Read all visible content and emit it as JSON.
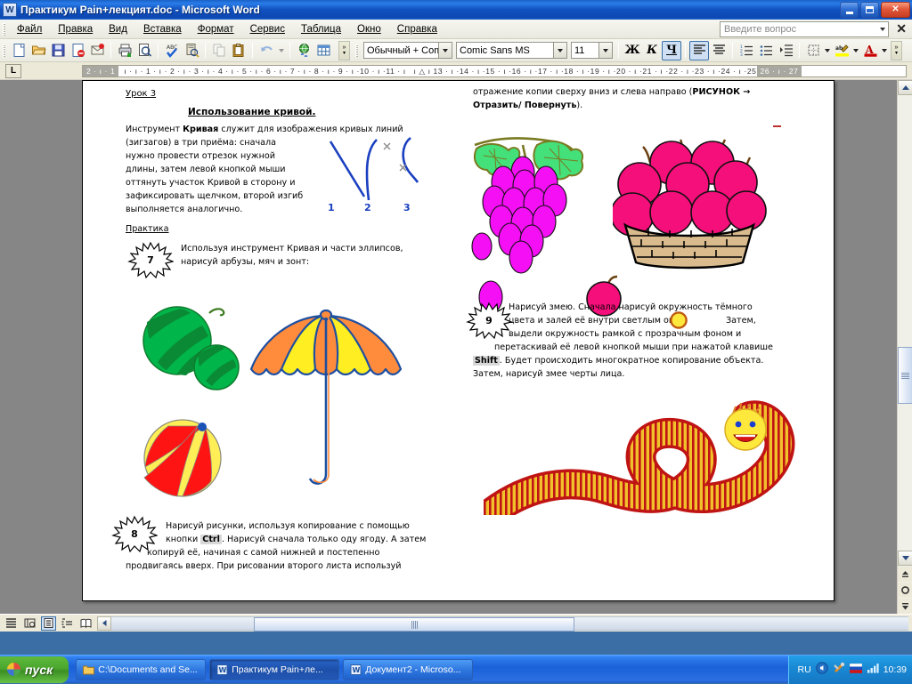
{
  "window": {
    "title": "Практикум  Pain+лекцият.doc - Microsoft Word",
    "icon": "word-document-icon",
    "minimize_label": "minimize",
    "maximize_label": "restore",
    "close_label": "close"
  },
  "menu": {
    "items": [
      "Файл",
      "Правка",
      "Вид",
      "Вставка",
      "Формат",
      "Сервис",
      "Таблица",
      "Окно",
      "Справка"
    ],
    "ask_placeholder": "Введите вопрос",
    "close_label": "✕"
  },
  "standard_toolbar": {
    "buttons": [
      "new-document-icon",
      "open-folder-icon",
      "save-icon",
      "mail-recipient-icon",
      "print-preview-mail-icon",
      "print-icon",
      "preview-icon",
      "spelling-check-icon",
      "research-icon",
      "copy-icon",
      "paste-icon",
      "undo-icon",
      "undo-dropdown-icon",
      "insert-hyperlink-icon",
      "insert-table-icon",
      "toolbar-options-icon"
    ]
  },
  "formatting_toolbar": {
    "style": "Обычный + Com",
    "font": "Comic Sans MS",
    "size": "11",
    "bold_label": "Ж",
    "italic_label": "К",
    "underline_label": "Ч",
    "align_left": "align-left-icon",
    "align_center": "align-center-icon",
    "numbered_list": "numbered-list-icon",
    "bulleted_list": "bulleted-list-icon",
    "increase_indent": "increase-indent-icon",
    "borders": "borders-icon",
    "highlight": "highlight-icon",
    "font_color": "font-color-icon",
    "highlight_color": "#ffff00",
    "font_color_value": "#cc0000",
    "accent": "#3a6ea5"
  },
  "ruler": {
    "left_margin_label": "2 · ı · 1",
    "ticks": [
      "1",
      "2",
      "3",
      "4",
      "5",
      "6",
      "7",
      "8",
      "9",
      "10",
      "11",
      "12",
      "13",
      "14",
      "15",
      "16",
      "17",
      "18",
      "19",
      "20",
      "21",
      "22",
      "23",
      "24",
      "25"
    ],
    "right_margin_label": "26 · ı · 27",
    "tab_selector": "L"
  },
  "document": {
    "lesson_heading": "Урок 3",
    "section_title": "Использование  кривой.",
    "intro_lead": "Инструмент ",
    "intro_bold": "Кривая",
    "intro_rest": " служит для изображения кривых линий",
    "intro_lines": [
      "(зигзагов) в три приёма: сначала",
      "нужно провести отрезок нужной",
      "длины, затем левой кнопкой мыши",
      "оттянуть участок Кривой в сторону и",
      "зафиксировать щелчком, второй изгиб",
      "выполняется аналогично."
    ],
    "curve_labels": [
      "1",
      "2",
      "3"
    ],
    "practice_heading": "Практика",
    "task7": {
      "number": "7",
      "lines": [
        "Используя инструмент Кривая и части эллипсов,",
        "нарисуй арбузы, мяч и зонт:"
      ]
    },
    "task8": {
      "number": "8",
      "line1_a": "Нарисуй рисунки, используя копирование с помощью",
      "line2_a": "кнопки ",
      "line2_kbd": "Ctrl",
      "line2_b": ". Нарисуй сначала только оду ягоду. А затем",
      "line3": "копируй её, начиная с самой нижней и  постепенно",
      "line4": "продвигаясь вверх. При рисовании второго листа используй"
    },
    "right_top": {
      "line1_a": "отражение копии сверху вниз и слева направо (",
      "line1_bold": "РИСУНОК  →",
      "line2_bold": "Отразить/ Повернуть",
      "line2_rest": ")."
    },
    "task9": {
      "number": "9",
      "line1": "Нарисуй змею. Сначала нарисуй окружность тёмного",
      "line2_a": "цвета и залей её внутри светлым ",
      "line2_b": "ом.",
      "line2_c": "Затем,",
      "line3": "выдели окружность рамкой с прозрачным фоном и",
      "line4": "перетаскивай её левой кнопкой мыши при нажатой клавише",
      "line5_kbd": "Shift",
      "line5_rest": ". Будет происходить многократное копирование объекта.",
      "line6": "Затем, нарисуй змее черты лица."
    },
    "figures": {
      "watermelon": "watermelon-illustration",
      "ball": "beach-ball-illustration",
      "umbrella": "umbrella-illustration",
      "grapes": "grapes-illustration",
      "apples": "apple-basket-illustration",
      "worm": "worm-snake-illustration",
      "curves": "curve-examples-illustration"
    }
  },
  "statusbar": {
    "view_buttons": [
      "normal-view-icon",
      "web-layout-view-icon",
      "print-layout-view-icon",
      "outline-view-icon",
      "reading-layout-icon"
    ]
  },
  "taskbar": {
    "start_label": "пуск",
    "items": [
      {
        "label": "C:\\Documents and Se...",
        "icon": "folder-icon",
        "active": false
      },
      {
        "label": "Практикум  Pain+ле...",
        "icon": "word-document-icon",
        "active": true
      },
      {
        "label": "Документ2 - Microso...",
        "icon": "word-document-icon",
        "active": false
      }
    ],
    "tray": {
      "language": "RU",
      "icons": [
        "volume-icon",
        "network-icon",
        "flag-icon",
        "signal-icon"
      ],
      "clock": "10:39"
    }
  }
}
